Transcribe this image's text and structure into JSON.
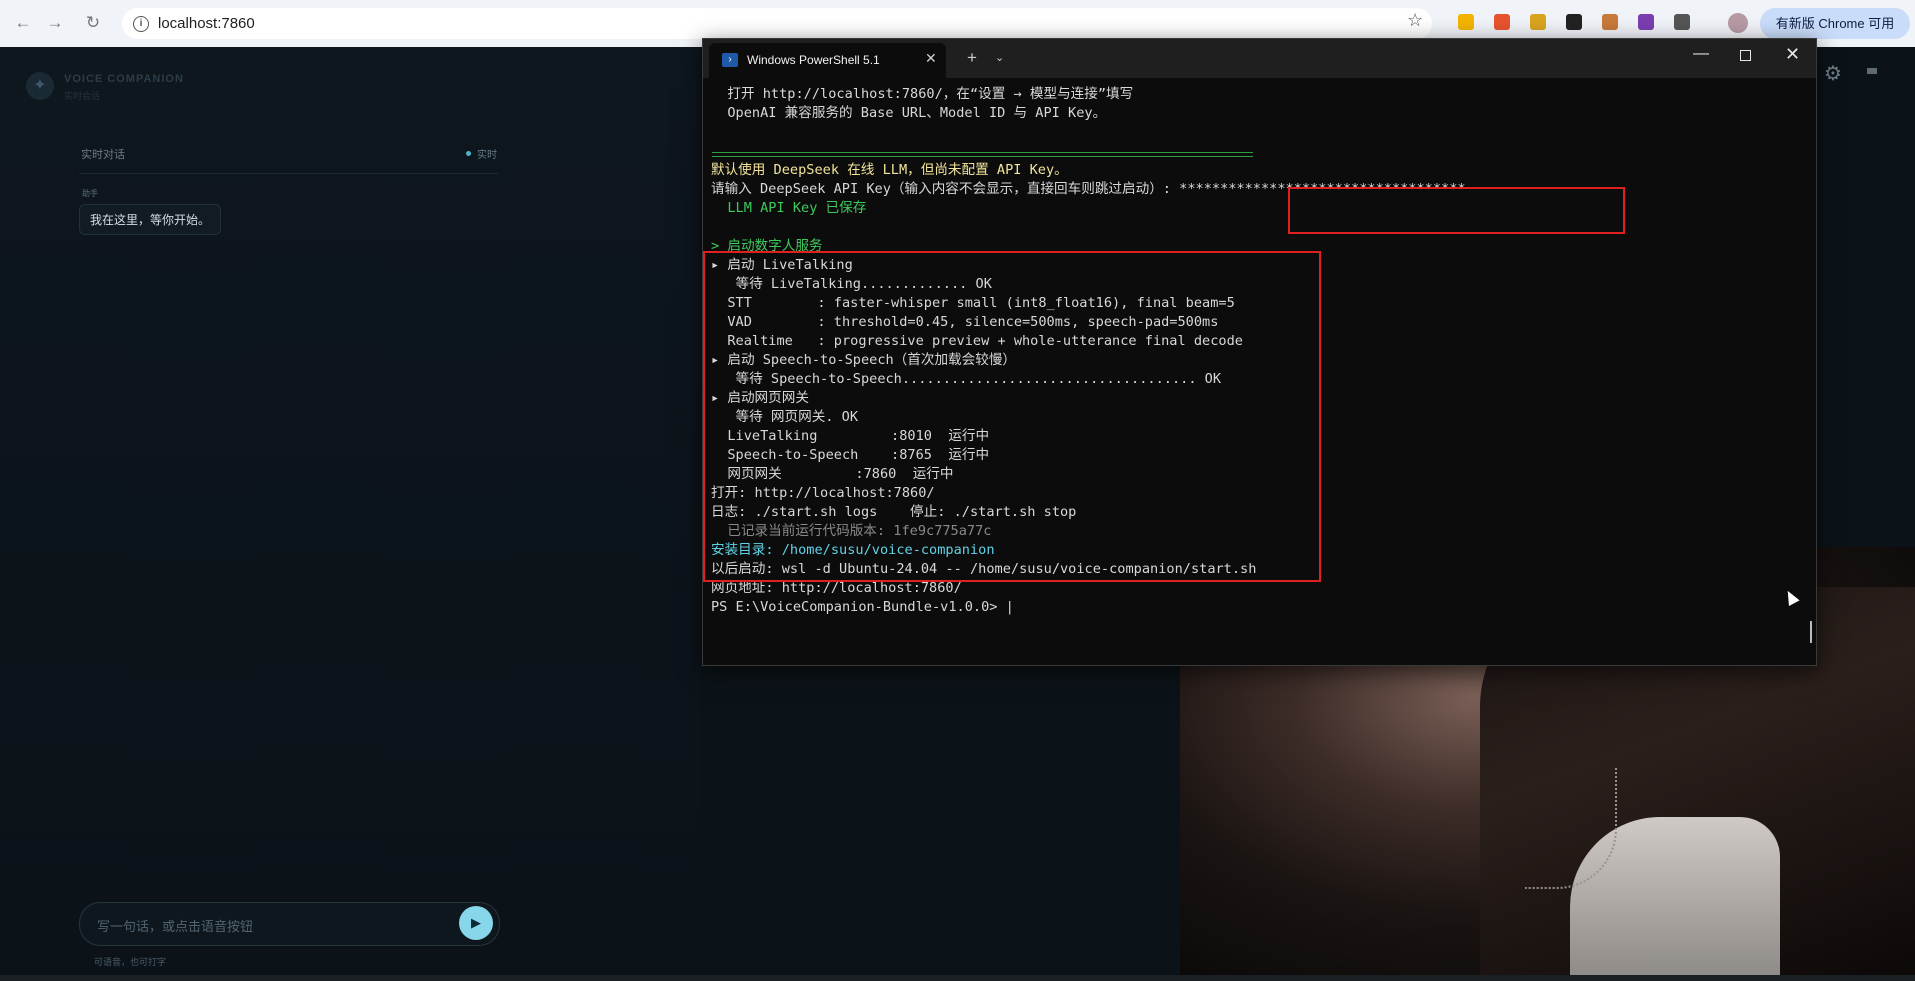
{
  "browser": {
    "url": "localhost:7860",
    "update_label": "有新版 Chrome 可用"
  },
  "app": {
    "brand_name": "VOICE COMPANION",
    "brand_sub": "实时会话",
    "chat_title": "实时对话",
    "live_label": "实时",
    "role_label": "助手",
    "message": "我在这里，等你开始。",
    "input_placeholder": "写一句话，或点击语音按钮",
    "hint": "可语音，也可打字"
  },
  "powershell": {
    "tab_title": "Windows PowerShell 5.1",
    "lines": [
      {
        "text": "  打开 http://localhost:7860/，在“设置 → 模型与连接”填写",
        "cls": ""
      },
      {
        "text": "  OpenAI 兼容服务的 Base URL、Model ID 与 API Key。",
        "cls": ""
      },
      {
        "text": "",
        "cls": ""
      },
      {
        "text": "",
        "cls": ""
      },
      {
        "text": "默认使用 DeepSeek 在线 LLM，但尚未配置 API Key。",
        "cls": "c-yellow"
      },
      {
        "text": "请输入 DeepSeek API Key（输入内容不会显示，直接回车则跳过启动）: ***********************************",
        "cls": ""
      },
      {
        "text": "  LLM API Key 已保存",
        "cls": "c-green"
      },
      {
        "text": "",
        "cls": ""
      },
      {
        "text": "> 启动数字人服务",
        "cls": "c-green"
      },
      {
        "text": "▸ 启动 LiveTalking",
        "cls": ""
      },
      {
        "text": "   等待 LiveTalking............. OK",
        "cls": ""
      },
      {
        "text": "  STT        : faster-whisper small (int8_float16), final beam=5",
        "cls": ""
      },
      {
        "text": "  VAD        : threshold=0.45, silence=500ms, speech-pad=500ms",
        "cls": ""
      },
      {
        "text": "  Realtime   : progressive preview + whole-utterance final decode",
        "cls": ""
      },
      {
        "text": "▸ 启动 Speech-to-Speech（首次加载会较慢）",
        "cls": ""
      },
      {
        "text": "   等待 Speech-to-Speech.................................... OK",
        "cls": ""
      },
      {
        "text": "▸ 启动网页网关",
        "cls": ""
      },
      {
        "text": "   等待 网页网关. OK",
        "cls": ""
      },
      {
        "text": "  LiveTalking         :8010  运行中",
        "cls": ""
      },
      {
        "text": "  Speech-to-Speech    :8765  运行中",
        "cls": ""
      },
      {
        "text": "  网页网关         :7860  运行中",
        "cls": ""
      },
      {
        "text": "打开: http://localhost:7860/",
        "cls": ""
      },
      {
        "text": "日志: ./start.sh logs    停止: ./start.sh stop",
        "cls": ""
      },
      {
        "text": "  已记录当前运行代码版本: 1fe9c775a77c",
        "cls": "c-dim"
      },
      {
        "text": "安装目录: /home/susu/voice-companion",
        "cls": "c-cyan"
      },
      {
        "text": "以后启动: wsl -d Ubuntu-24.04 -- /home/susu/voice-companion/start.sh",
        "cls": ""
      },
      {
        "text": "网页地址: http://localhost:7860/",
        "cls": ""
      },
      {
        "text": "PS E:\\VoiceCompanion-Bundle-v1.0.0> |",
        "cls": ""
      }
    ]
  },
  "colors": {
    "accent": "#88d6ea",
    "highlight_box": "#e02020",
    "terminal_green": "#3fc95c",
    "terminal_yellow": "#f2e49a",
    "terminal_cyan": "#5fd3e6"
  }
}
